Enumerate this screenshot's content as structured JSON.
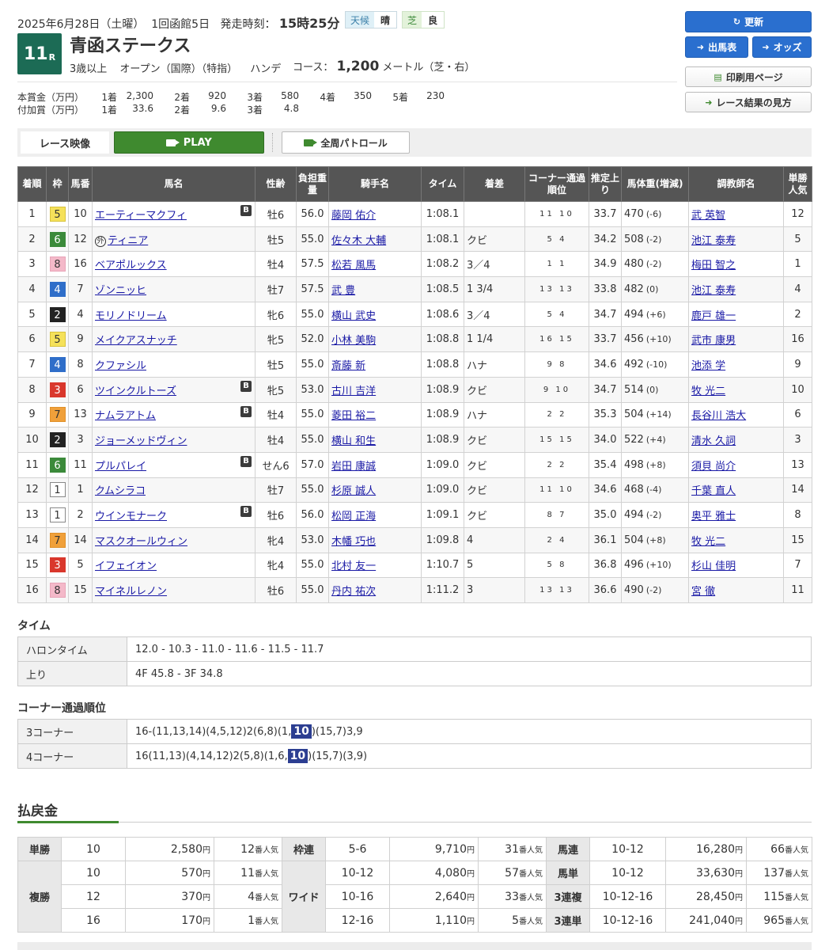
{
  "header": {
    "date": "2025年6月28日（土曜）",
    "meeting": "1回函館5日",
    "post_time_label": "発走時刻：",
    "post_time": "15時25分",
    "weather_label": "天候",
    "weather": "晴",
    "track_label": "芝",
    "track_condition": "良"
  },
  "race": {
    "number": "11",
    "number_suffix": "R",
    "name": "青函ステークス",
    "conditions": [
      "3歳以上",
      "オープン（国際）（特指）",
      "ハンデ"
    ],
    "course_label": "コース：",
    "distance": "1,200",
    "distance_unit": "メートル（芝・右）"
  },
  "prize": {
    "main_label": "本賞金（万円）",
    "main": [
      [
        "1着",
        "2,300"
      ],
      [
        "2着",
        "920"
      ],
      [
        "3着",
        "580"
      ],
      [
        "4着",
        "350"
      ],
      [
        "5着",
        "230"
      ]
    ],
    "extra_label": "付加賞（万円）",
    "extra": [
      [
        "1着",
        "33.6"
      ],
      [
        "2着",
        "9.6"
      ],
      [
        "3着",
        "4.8"
      ]
    ]
  },
  "buttons": {
    "refresh": "更新",
    "entries": "出馬表",
    "odds": "オッズ",
    "print": "印刷用ページ",
    "howto": "レース結果の見方"
  },
  "video": {
    "label": "レース映像",
    "play": "PLAY",
    "patrol": "全周パトロール"
  },
  "table": {
    "headers": [
      "着順",
      "枠",
      "馬番",
      "馬名",
      "性齢",
      "負担重量",
      "騎手名",
      "タイム",
      "着差",
      "コーナー通過順位",
      "推定上り",
      "馬体重(増減)",
      "調教師名",
      "単勝人気"
    ],
    "rows": [
      {
        "pos": "1",
        "waku": "5",
        "num": "10",
        "name": "エーティーマクフィ",
        "blinker": true,
        "foreign": false,
        "sex": "牡6",
        "wt": "56.0",
        "jockey": "藤岡 佑介",
        "time": "1:08.1",
        "margin": "",
        "corner": "11 10",
        "last": "33.7",
        "bw": "470",
        "bwd": "(-6)",
        "trainer": "武 英智",
        "pop": "12"
      },
      {
        "pos": "2",
        "waku": "6",
        "num": "12",
        "name": "ティニア",
        "blinker": false,
        "foreign": true,
        "sex": "牡5",
        "wt": "55.0",
        "jockey": "佐々木 大輔",
        "time": "1:08.1",
        "margin": "クビ",
        "corner": "5 4",
        "last": "34.2",
        "bw": "508",
        "bwd": "(-2)",
        "trainer": "池江 泰寿",
        "pop": "5"
      },
      {
        "pos": "3",
        "waku": "8",
        "num": "16",
        "name": "ベアポルックス",
        "blinker": false,
        "foreign": false,
        "sex": "牡4",
        "wt": "57.5",
        "jockey": "松若 風馬",
        "time": "1:08.2",
        "margin": "3／4",
        "corner": "1 1",
        "last": "34.9",
        "bw": "480",
        "bwd": "(-2)",
        "trainer": "梅田 智之",
        "pop": "1"
      },
      {
        "pos": "4",
        "waku": "4",
        "num": "7",
        "name": "ゾンニッヒ",
        "blinker": false,
        "foreign": false,
        "sex": "牡7",
        "wt": "57.5",
        "jockey": "武 豊",
        "time": "1:08.5",
        "margin": "1 3/4",
        "corner": "13 13",
        "last": "33.8",
        "bw": "482",
        "bwd": "(0)",
        "trainer": "池江 泰寿",
        "pop": "4"
      },
      {
        "pos": "5",
        "waku": "2",
        "num": "4",
        "name": "モリノドリーム",
        "blinker": false,
        "foreign": false,
        "sex": "牝6",
        "wt": "55.0",
        "jockey": "横山 武史",
        "time": "1:08.6",
        "margin": "3／4",
        "corner": "5 4",
        "last": "34.7",
        "bw": "494",
        "bwd": "(+6)",
        "trainer": "鹿戸 雄一",
        "pop": "2"
      },
      {
        "pos": "6",
        "waku": "5",
        "num": "9",
        "name": "メイクアスナッチ",
        "blinker": false,
        "foreign": false,
        "sex": "牝5",
        "wt": "52.0",
        "jockey": "小林 美駒",
        "time": "1:08.8",
        "margin": "1 1/4",
        "corner": "16 15",
        "last": "33.7",
        "bw": "456",
        "bwd": "(+10)",
        "trainer": "武市 康男",
        "pop": "16"
      },
      {
        "pos": "7",
        "waku": "4",
        "num": "8",
        "name": "クファシル",
        "blinker": false,
        "foreign": false,
        "sex": "牡5",
        "wt": "55.0",
        "jockey": "斎藤 新",
        "time": "1:08.8",
        "margin": "ハナ",
        "corner": "9 8",
        "last": "34.6",
        "bw": "492",
        "bwd": "(-10)",
        "trainer": "池添 学",
        "pop": "9"
      },
      {
        "pos": "8",
        "waku": "3",
        "num": "6",
        "name": "ツインクルトーズ",
        "blinker": true,
        "foreign": false,
        "sex": "牝5",
        "wt": "53.0",
        "jockey": "古川 吉洋",
        "time": "1:08.9",
        "margin": "クビ",
        "corner": "9 10",
        "last": "34.7",
        "bw": "514",
        "bwd": "(0)",
        "trainer": "牧 光二",
        "pop": "10"
      },
      {
        "pos": "9",
        "waku": "7",
        "num": "13",
        "name": "ナムラアトム",
        "blinker": true,
        "foreign": false,
        "sex": "牡4",
        "wt": "55.0",
        "jockey": "菱田 裕二",
        "time": "1:08.9",
        "margin": "ハナ",
        "corner": "2 2",
        "last": "35.3",
        "bw": "504",
        "bwd": "(+14)",
        "trainer": "長谷川 浩大",
        "pop": "6"
      },
      {
        "pos": "10",
        "waku": "2",
        "num": "3",
        "name": "ジョーメッドヴィン",
        "blinker": false,
        "foreign": false,
        "sex": "牡4",
        "wt": "55.0",
        "jockey": "横山 和生",
        "time": "1:08.9",
        "margin": "クビ",
        "corner": "15 15",
        "last": "34.0",
        "bw": "522",
        "bwd": "(+4)",
        "trainer": "清水 久詞",
        "pop": "3"
      },
      {
        "pos": "11",
        "waku": "6",
        "num": "11",
        "name": "プルパレイ",
        "blinker": true,
        "foreign": false,
        "sex": "せん6",
        "wt": "57.0",
        "jockey": "岩田 康誠",
        "time": "1:09.0",
        "margin": "クビ",
        "corner": "2 2",
        "last": "35.4",
        "bw": "498",
        "bwd": "(+8)",
        "trainer": "須貝 尚介",
        "pop": "13"
      },
      {
        "pos": "12",
        "waku": "1",
        "num": "1",
        "name": "クムシラコ",
        "blinker": false,
        "foreign": false,
        "sex": "牡7",
        "wt": "55.0",
        "jockey": "杉原 誠人",
        "time": "1:09.0",
        "margin": "クビ",
        "corner": "11 10",
        "last": "34.6",
        "bw": "468",
        "bwd": "(-4)",
        "trainer": "千葉 直人",
        "pop": "14"
      },
      {
        "pos": "13",
        "waku": "1",
        "num": "2",
        "name": "ウインモナーク",
        "blinker": true,
        "foreign": false,
        "sex": "牡6",
        "wt": "56.0",
        "jockey": "松岡 正海",
        "time": "1:09.1",
        "margin": "クビ",
        "corner": "8 7",
        "last": "35.0",
        "bw": "494",
        "bwd": "(-2)",
        "trainer": "奥平 雅士",
        "pop": "8"
      },
      {
        "pos": "14",
        "waku": "7",
        "num": "14",
        "name": "マスクオールウィン",
        "blinker": false,
        "foreign": false,
        "sex": "牝4",
        "wt": "53.0",
        "jockey": "木幡 巧也",
        "time": "1:09.8",
        "margin": "4",
        "corner": "2 4",
        "last": "36.1",
        "bw": "504",
        "bwd": "(+8)",
        "trainer": "牧 光二",
        "pop": "15"
      },
      {
        "pos": "15",
        "waku": "3",
        "num": "5",
        "name": "イフェイオン",
        "blinker": false,
        "foreign": false,
        "sex": "牝4",
        "wt": "55.0",
        "jockey": "北村 友一",
        "time": "1:10.7",
        "margin": "5",
        "corner": "5 8",
        "last": "36.8",
        "bw": "496",
        "bwd": "(+10)",
        "trainer": "杉山 佳明",
        "pop": "7"
      },
      {
        "pos": "16",
        "waku": "8",
        "num": "15",
        "name": "マイネルレノン",
        "blinker": false,
        "foreign": false,
        "sex": "牡6",
        "wt": "55.0",
        "jockey": "丹内 祐次",
        "time": "1:11.2",
        "margin": "3",
        "corner": "13 13",
        "last": "36.6",
        "bw": "490",
        "bwd": "(-2)",
        "trainer": "宮 徹",
        "pop": "11"
      }
    ]
  },
  "waku_colors": {
    "1": {
      "bg": "#ffffff",
      "fg": "#333333",
      "border": "#888888"
    },
    "2": {
      "bg": "#222222",
      "fg": "#ffffff",
      "border": "#222222"
    },
    "3": {
      "bg": "#d9372c",
      "fg": "#ffffff",
      "border": "#d9372c"
    },
    "4": {
      "bg": "#2f6ec9",
      "fg": "#ffffff",
      "border": "#2f6ec9"
    },
    "5": {
      "bg": "#f5e15a",
      "fg": "#333333",
      "border": "#d8c33d"
    },
    "6": {
      "bg": "#3b8a3a",
      "fg": "#ffffff",
      "border": "#3b8a3a"
    },
    "7": {
      "bg": "#f0a03a",
      "fg": "#333333",
      "border": "#e0902a"
    },
    "8": {
      "bg": "#f4b9c9",
      "fg": "#333333",
      "border": "#e8a4b8"
    }
  },
  "time": {
    "title": "タイム",
    "furlong_label": "ハロンタイム",
    "furlong": "12.0 - 10.3 - 11.0 - 11.6 - 11.5 - 11.7",
    "last_label": "上り",
    "last": "4F 45.8 - 3F 34.8"
  },
  "corners": {
    "title": "コーナー通過順位",
    "c3_label": "3コーナー",
    "c3_pre": "16-(11,13,14)(4,5,12)2(6,8)(1,",
    "c3_hl": "10",
    "c3_post": ")(15,7)3,9",
    "c4_label": "4コーナー",
    "c4_pre": "16(11,13)(4,14,12)2(5,8)(1,6,",
    "c4_hl": "10",
    "c4_post": ")(15,7)(3,9)"
  },
  "payout": {
    "title": "払戻金",
    "yen": "円",
    "pop_suffix": "番人気",
    "tansho_label": "単勝",
    "tansho": [
      {
        "num": "10",
        "amt": "2,580",
        "pop": "12"
      }
    ],
    "fukusho_label": "複勝",
    "fukusho": [
      {
        "num": "10",
        "amt": "570",
        "pop": "11"
      },
      {
        "num": "12",
        "amt": "370",
        "pop": "4"
      },
      {
        "num": "16",
        "amt": "170",
        "pop": "1"
      }
    ],
    "wakuren_label": "枠連",
    "wakuren": [
      {
        "num": "5-6",
        "amt": "9,710",
        "pop": "31"
      }
    ],
    "wide_label": "ワイド",
    "wide": [
      {
        "num": "10-12",
        "amt": "4,080",
        "pop": "57"
      },
      {
        "num": "10-16",
        "amt": "2,640",
        "pop": "33"
      },
      {
        "num": "12-16",
        "amt": "1,110",
        "pop": "5"
      }
    ],
    "umaren_label": "馬連",
    "umaren": {
      "num": "10-12",
      "amt": "16,280",
      "pop": "66"
    },
    "umatan_label": "馬単",
    "umatan": {
      "num": "10-12",
      "amt": "33,630",
      "pop": "137"
    },
    "sanrenpuku_label": "3連複",
    "sanrenpuku": {
      "num": "10-12-16",
      "amt": "28,450",
      "pop": "115"
    },
    "sanrentan_label": "3連単",
    "sanrentan": {
      "num": "10-12-16",
      "amt": "241,040",
      "pop": "965"
    }
  }
}
